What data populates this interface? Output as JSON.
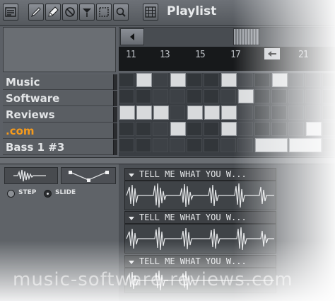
{
  "window": {
    "title": "Playlist"
  },
  "toolbar": {
    "tools": [
      "playlist-menu-icon",
      "pencil-icon",
      "paint-icon",
      "delete-icon",
      "mute-icon",
      "slice-icon",
      "select-icon",
      "zoom-icon"
    ],
    "snap_tool": "grid-icon"
  },
  "ruler": {
    "ticks": [
      "11",
      "13",
      "15",
      "17",
      "21"
    ]
  },
  "tracks": [
    {
      "label": "Music"
    },
    {
      "label": "Software"
    },
    {
      "label": "Reviews"
    },
    {
      "label": ".com"
    },
    {
      "label": "Bass 1 #3"
    }
  ],
  "envelope": {
    "step_label": "STEP",
    "slide_label": "SLIDE"
  },
  "clips": [
    {
      "title": "TELL ME WHAT YOU W..."
    },
    {
      "title": "TELL ME WHAT YOU W..."
    },
    {
      "title": "TELL ME WHAT YOU W..."
    }
  ],
  "watermark": "music-software-reviews.com"
}
